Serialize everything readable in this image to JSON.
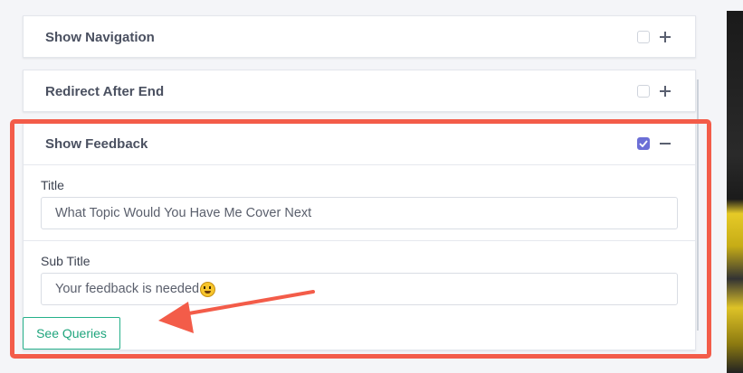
{
  "panels": {
    "show_navigation": {
      "title": "Show Navigation",
      "checked": false,
      "expanded": false
    },
    "redirect_after_end": {
      "title": "Redirect After End",
      "checked": false,
      "expanded": false
    },
    "show_feedback": {
      "title": "Show Feedback",
      "checked": true,
      "expanded": true,
      "title_label": "Title",
      "title_value": "What Topic Would You Have Me Cover Next",
      "subtitle_label": "Sub Title",
      "subtitle_value": "Your feedback is needed"
    }
  },
  "buttons": {
    "see_queries": "See Queries"
  },
  "colors": {
    "accent_checkbox": "#6c6fd6",
    "button_outline": "#25b08a",
    "annotation": "#f35c49"
  },
  "icons": {
    "expand": "plus-icon",
    "collapse": "minus-icon",
    "emoji": "grinning-face-emoji"
  }
}
